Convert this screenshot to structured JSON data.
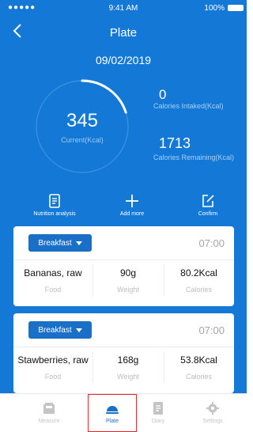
{
  "status_bar": {
    "signal": "●●●●● ",
    "time": "9:41 AM",
    "battery": "100%"
  },
  "header": {
    "title": "Plate",
    "date": "09/02/2019"
  },
  "summary": {
    "current_value": "345",
    "current_label": "Current(Kcal)",
    "intake_value": "0",
    "intake_label": "Calories Intaked(Kcal)",
    "remaining_value": "1713",
    "remaining_label": "Calories Remaining(Kcal)",
    "ring_progress_fraction": 0.2
  },
  "actions": [
    {
      "label": "Nutrition analysis",
      "icon": "document-icon"
    },
    {
      "label": "Add more",
      "icon": "plus-icon"
    },
    {
      "label": "Confirm",
      "icon": "edit-icon"
    }
  ],
  "meals": [
    {
      "meal": "Breakfast",
      "time": "07:00",
      "food": "Bananas, raw",
      "weight": "90g",
      "calories": "80.2Kcal",
      "food_label": "Food",
      "weight_label": "Weight",
      "calories_label": "Calories"
    },
    {
      "meal": "Breakfast",
      "time": "07:00",
      "food": "Stawberries, raw",
      "weight": "168g",
      "calories": "53.8Kcal",
      "food_label": "Food",
      "weight_label": "Weight",
      "calories_label": "Calories"
    }
  ],
  "tabs": [
    {
      "label": "Measure",
      "icon": "scale-icon",
      "active": false
    },
    {
      "label": "Plate",
      "icon": "plate-icon",
      "active": true
    },
    {
      "label": "Diary",
      "icon": "diary-icon",
      "active": false
    },
    {
      "label": "Settings",
      "icon": "gear-icon",
      "active": false
    }
  ],
  "colors": {
    "primary": "#1479d6",
    "button": "#1a6fc6",
    "highlight": "#d9262a"
  }
}
